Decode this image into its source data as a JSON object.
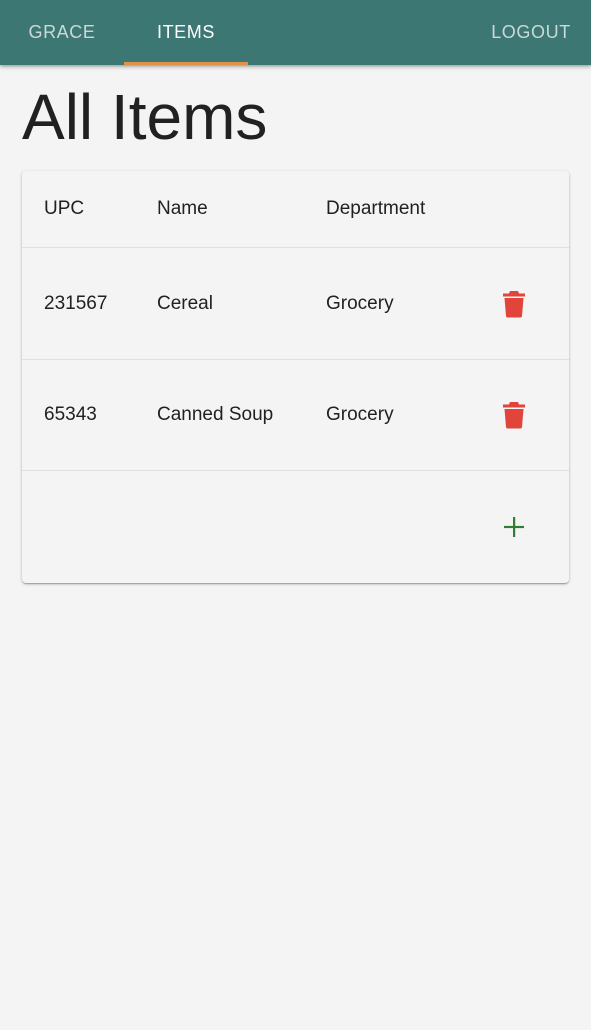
{
  "nav": {
    "tabs": [
      {
        "label": "GRACE",
        "active": false
      },
      {
        "label": "ITEMS",
        "active": true
      }
    ],
    "logout_label": "LOGOUT",
    "bar_color": "#3c7773",
    "indicator_color": "#e1914a"
  },
  "page": {
    "title": "All Items"
  },
  "table": {
    "headers": [
      "UPC",
      "Name",
      "Department"
    ],
    "rows": [
      {
        "upc": "231567",
        "name": "Cereal",
        "department": "Grocery",
        "action_icon": "trash-icon"
      },
      {
        "upc": "65343",
        "name": "Canned Soup",
        "department": "Grocery",
        "action_icon": "trash-icon"
      }
    ],
    "add_icon": "plus-icon",
    "delete_color": "#e0443a",
    "add_color": "#2e7d32"
  }
}
